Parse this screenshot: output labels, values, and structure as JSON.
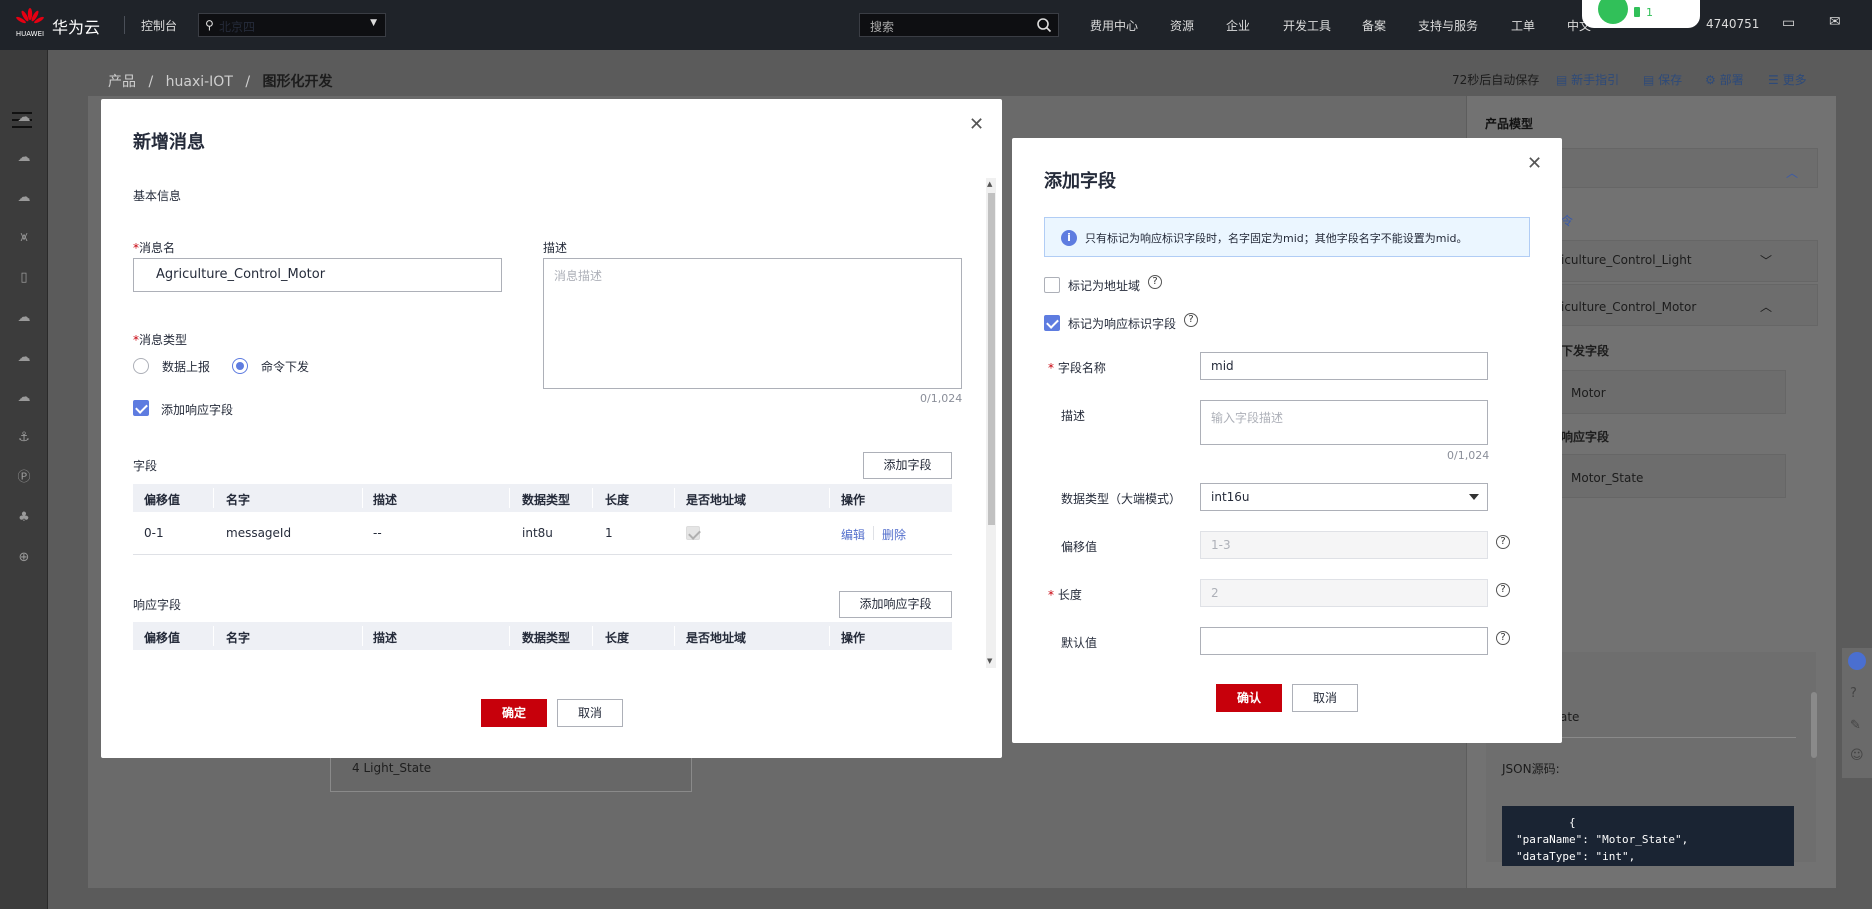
{
  "topbar": {
    "brand": "华为云",
    "logo_text": "HUAWEI",
    "console": "控制台",
    "region": "北京四",
    "search_placeholder": "搜索",
    "nav": [
      "费用中心",
      "资源",
      "企业",
      "开发工具",
      "备案",
      "支持与服务",
      "工单",
      "中文"
    ],
    "account_suffix": "4740751",
    "wifi_count": "1"
  },
  "breadcrumb": {
    "items": [
      "产品",
      "huaxi-IOT"
    ],
    "current": "图形化开发",
    "sep": "/"
  },
  "top_actions": {
    "autosave": "72秒后自动保存",
    "guide": "新手指引",
    "save": "保存",
    "deploy": "部署",
    "more": "更多"
  },
  "right_panel": {
    "title": "产品模型",
    "cmd_label": "令",
    "cmd1": "iculture_Control_Light",
    "cmd2": "iculture_Control_Motor",
    "down_field_label": "下发字段",
    "motor": "Motor",
    "resp_field_label": "响应字段",
    "motor_state": "Motor_State",
    "state_partial": "ate",
    "json_label": "JSON源码:",
    "json_code": "        {\n\"paraName\": \"Motor_State\",\n\"dataType\": \"int\","
  },
  "canvas_node": "4   Light_State",
  "dialog_message": {
    "title": "新增消息",
    "section_basic": "基本信息",
    "name_label": "消息名",
    "name_value": "Agriculture_Control_Motor",
    "desc_label": "描述",
    "desc_placeholder": "消息描述",
    "desc_counter": "0/1,024",
    "type_label": "消息类型",
    "type_options": [
      "数据上报",
      "命令下发"
    ],
    "type_selected": "命令下发",
    "add_response": "添加响应字段",
    "add_response_checked": true,
    "fields_label": "字段",
    "add_field_btn": "添加字段",
    "columns": [
      "偏移值",
      "名字",
      "描述",
      "数据类型",
      "长度",
      "是否地址域",
      "操作"
    ],
    "rows": [
      {
        "offset": "0-1",
        "name": "messageId",
        "desc": "--",
        "type": "int8u",
        "length": "1",
        "is_address": true,
        "edit": "编辑",
        "delete": "删除"
      }
    ],
    "resp_fields_label": "响应字段",
    "add_resp_btn": "添加响应字段",
    "ok": "确定",
    "cancel": "取消"
  },
  "dialog_field": {
    "title": "添加字段",
    "info": "只有标记为响应标识字段时，名字固定为mid；其他字段名字不能设置为mid。",
    "mark_address": "标记为地址域",
    "mark_address_checked": false,
    "mark_resp": "标记为响应标识字段",
    "mark_resp_checked": true,
    "name_label": "字段名称",
    "name_value": "mid",
    "desc_label": "描述",
    "desc_placeholder": "输入字段描述",
    "desc_counter": "0/1,024",
    "type_label": "数据类型（大端模式）",
    "type_value": "int16u",
    "offset_label": "偏移值",
    "offset_value": "1-3",
    "length_label": "长度",
    "length_value": "2",
    "default_label": "默认值",
    "default_value": "",
    "confirm": "确认",
    "cancel": "取消"
  },
  "colors": {
    "primary_red": "#c7000b",
    "accent_blue": "#5e7ce0",
    "topbar_bg": "#1f2329"
  }
}
